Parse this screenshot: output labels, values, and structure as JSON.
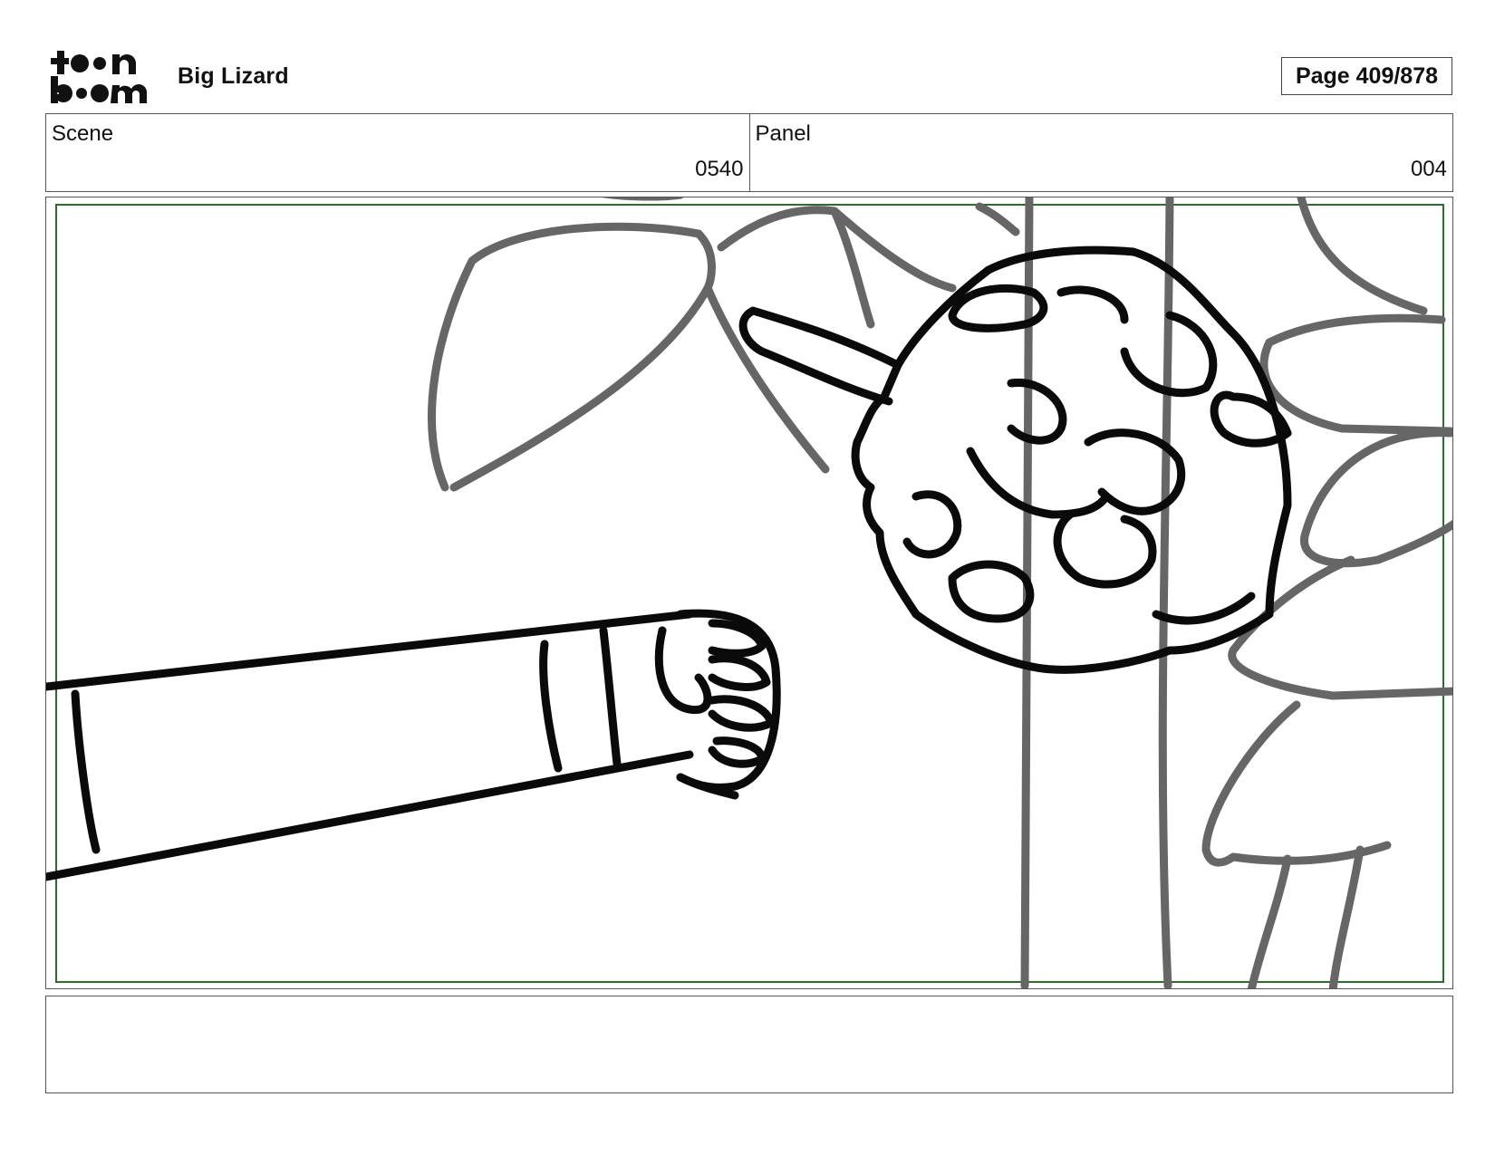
{
  "header": {
    "logo_top": "t••n",
    "logo_bottom": "b••m",
    "project_title": "Big Lizard",
    "page_indicator": "Page 409/878"
  },
  "scene": {
    "label": "Scene",
    "value": "0540"
  },
  "panel": {
    "label": "Panel",
    "value": "004"
  },
  "drawing": {
    "description_icon": "storyboard-sketch",
    "safe_area_color": "#2e6b2e"
  },
  "notes": {
    "text": ""
  }
}
